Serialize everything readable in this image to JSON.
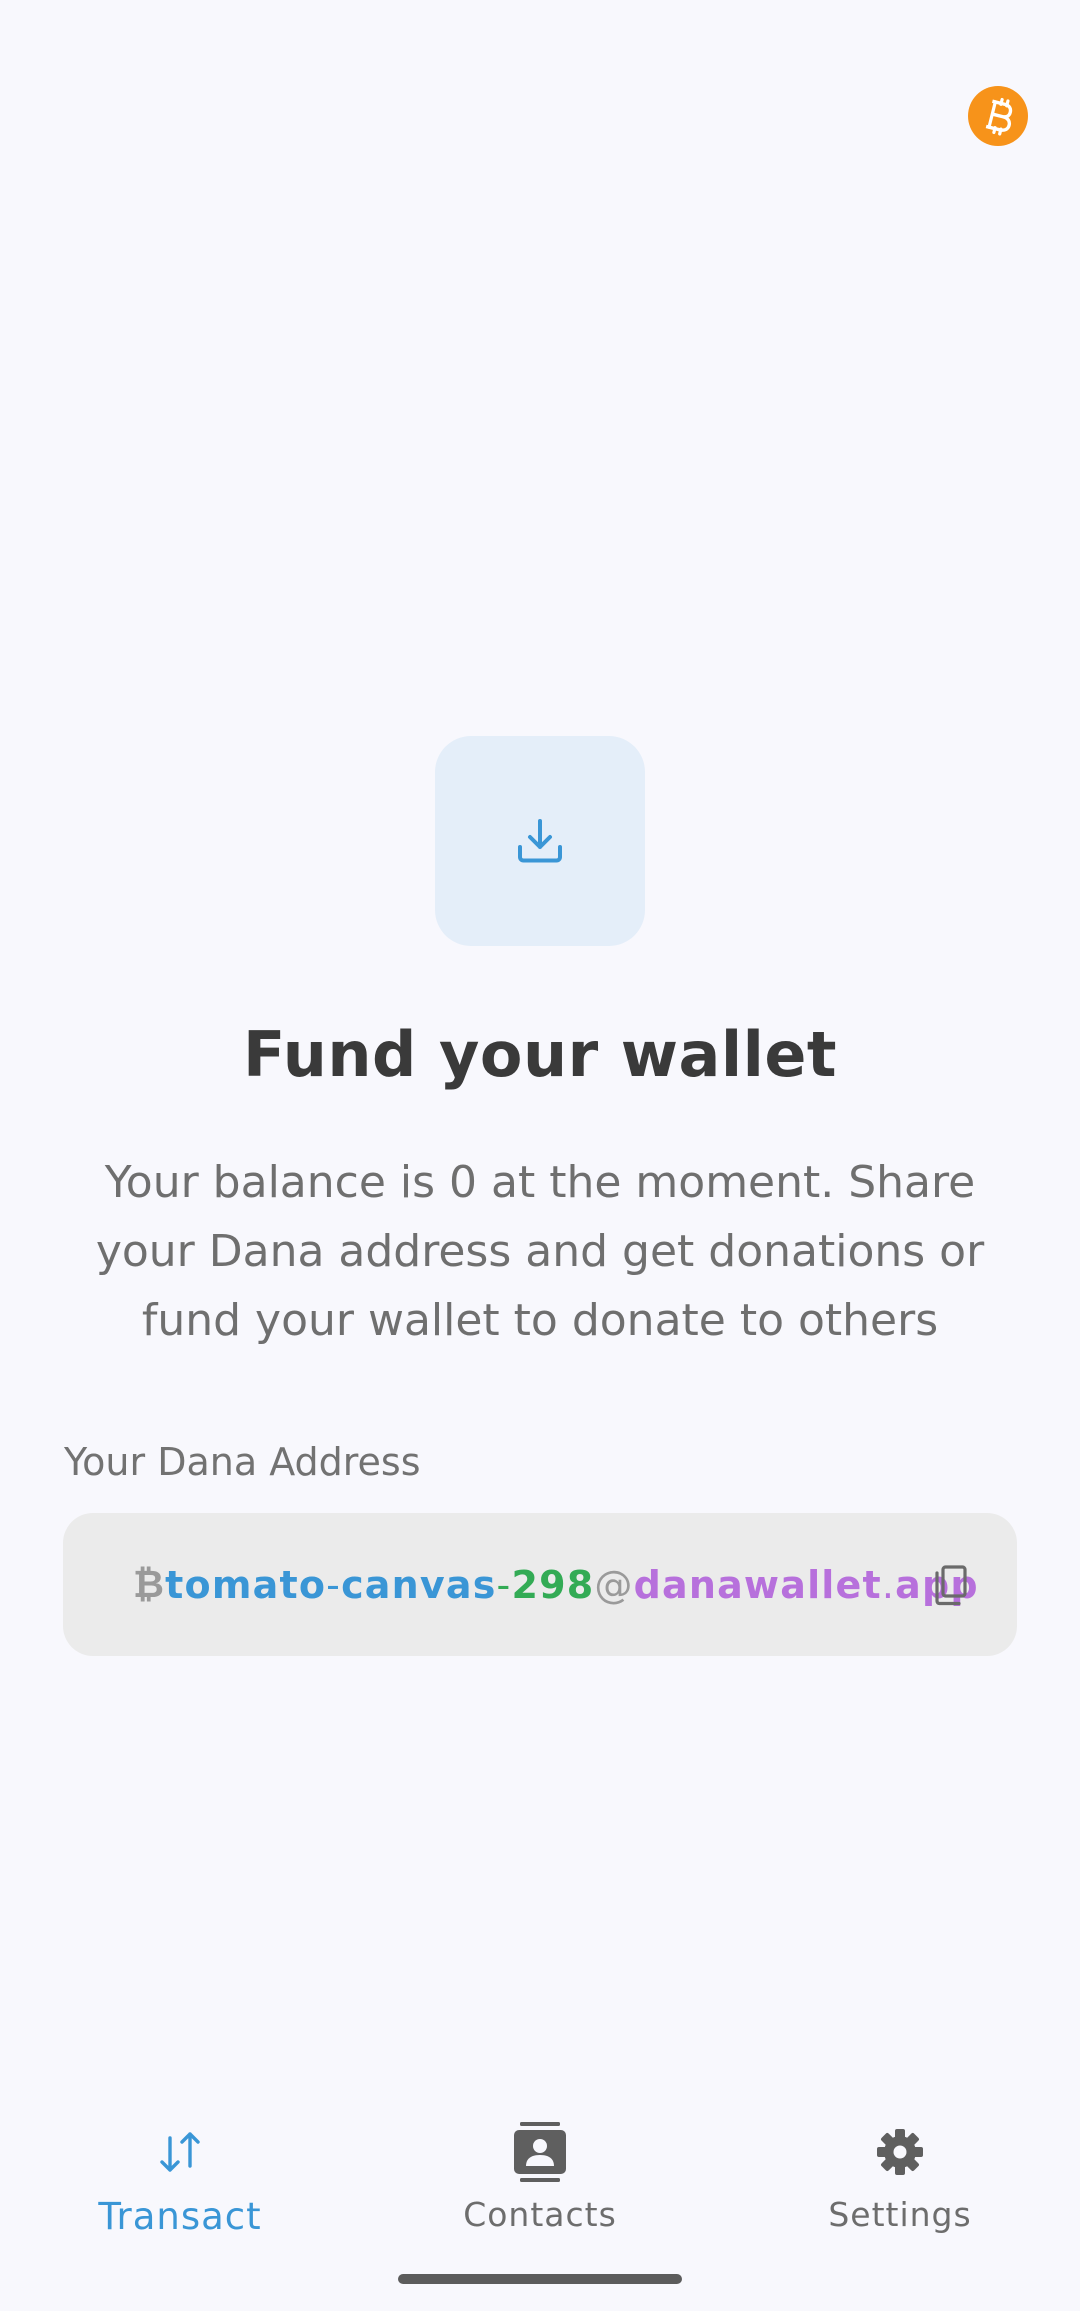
{
  "header": {
    "currency_icon": "bitcoin-icon",
    "currency_color": "#f7931a"
  },
  "main": {
    "icon": "download-icon",
    "title": "Fund your wallet",
    "description": "Your balance is 0 at the moment. Share your Dana address and get donations or fund your wallet to donate to others",
    "address_label": "Your Dana Address",
    "address": {
      "prefix": "₿",
      "word1": "tomato",
      "sep1": "-",
      "word2": "canvas",
      "sep2": "-",
      "number": "298",
      "at": "@",
      "domain_name": "danawallet",
      "dot": ".",
      "tld": "app"
    },
    "copy_icon": "copy-icon"
  },
  "bottom_nav": {
    "items": [
      {
        "label": "Transact",
        "icon": "transfer-arrows-icon",
        "active": true
      },
      {
        "label": "Contacts",
        "icon": "contacts-icon",
        "active": false
      },
      {
        "label": "Settings",
        "icon": "gear-icon",
        "active": false
      }
    ]
  },
  "colors": {
    "accent": "#3a96d6",
    "background": "#f8f8fd",
    "address_green": "#33ab55",
    "address_purple": "#b770dc"
  }
}
